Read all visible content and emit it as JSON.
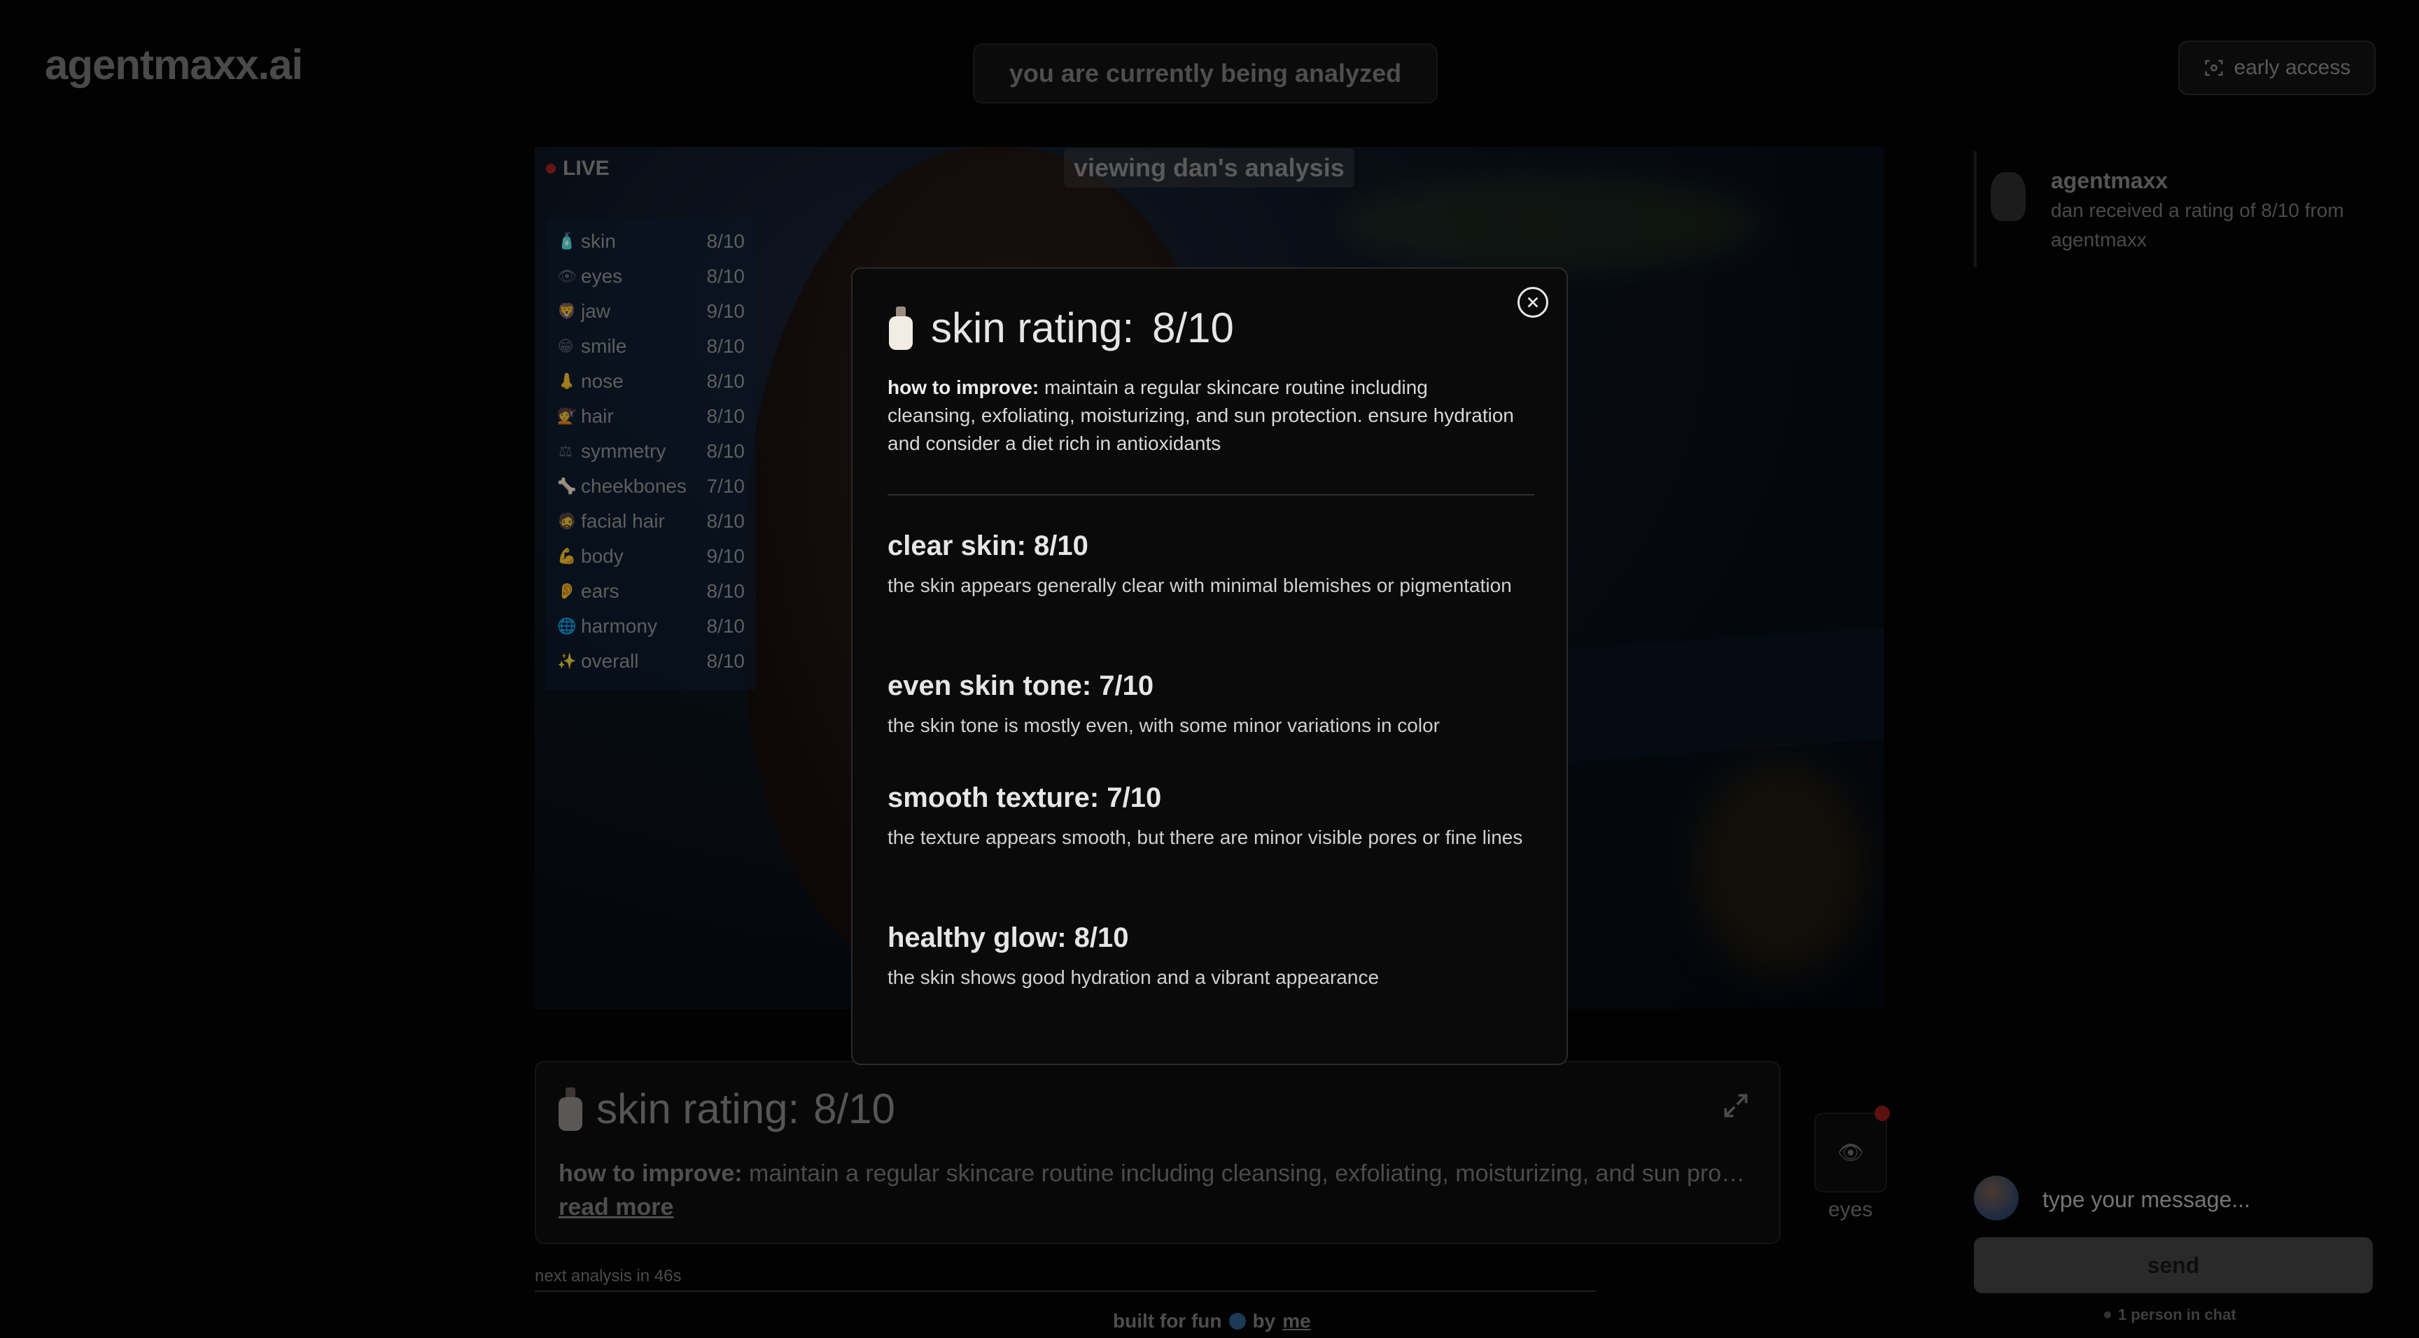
{
  "header": {
    "brand": "agentmaxx.ai",
    "status_pill": "you are currently being analyzed",
    "early_access_label": "early access"
  },
  "video": {
    "live_label": "LIVE",
    "viewing_label": "viewing dan's analysis",
    "ratings": [
      {
        "icon": "🧴",
        "label": "skin",
        "score": "8/10"
      },
      {
        "icon": "👁",
        "label": "eyes",
        "score": "8/10"
      },
      {
        "icon": "🦁",
        "label": "jaw",
        "score": "9/10"
      },
      {
        "icon": "😁",
        "label": "smile",
        "score": "8/10"
      },
      {
        "icon": "👃",
        "label": "nose",
        "score": "8/10"
      },
      {
        "icon": "💇",
        "label": "hair",
        "score": "8/10"
      },
      {
        "icon": "⚖",
        "label": "symmetry",
        "score": "8/10"
      },
      {
        "icon": "🦴",
        "label": "cheekbones",
        "score": "7/10"
      },
      {
        "icon": "🧔",
        "label": "facial hair",
        "score": "8/10"
      },
      {
        "icon": "💪",
        "label": "body",
        "score": "9/10"
      },
      {
        "icon": "👂",
        "label": "ears",
        "score": "8/10"
      },
      {
        "icon": "🌐",
        "label": "harmony",
        "score": "8/10"
      },
      {
        "icon": "✨",
        "label": "overall",
        "score": "8/10"
      }
    ]
  },
  "modal": {
    "title_label": "skin rating:",
    "title_score": "8/10",
    "improve_label": "how to improve:",
    "improve_text": "maintain a regular skincare routine including cleansing, exfoliating, moisturizing, and sun protection. ensure hydration and consider a diet rich in antioxidants",
    "sections": [
      {
        "heading": "clear skin: 8/10",
        "text": "the skin appears generally clear with minimal blemishes or pigmentation"
      },
      {
        "heading": "even skin tone: 7/10",
        "text": "the skin tone is mostly even, with some minor variations in color"
      },
      {
        "heading": "smooth texture: 7/10",
        "text": "the texture appears smooth, but there are minor visible pores or fine lines"
      },
      {
        "heading": "healthy glow: 8/10",
        "text": "the skin shows good hydration and a vibrant appearance"
      }
    ]
  },
  "card": {
    "title_label": "skin rating:",
    "title_score": "8/10",
    "improve_label": "how to improve:",
    "improve_text": "maintain a regular skincare routine including cleansing, exfoliating, moisturizing, and sun protection. ensure hydration and consider a diet rich in antioxidants",
    "read_more": "read more"
  },
  "side_indicator": {
    "label": "eyes"
  },
  "status": {
    "next_analysis": "next analysis in 46s"
  },
  "footer": {
    "text": "built for fun",
    "by": "by",
    "link": "me"
  },
  "chat": {
    "messages": [
      {
        "name": "agentmaxx",
        "text": "dan received a rating of 8/10 from agentmaxx"
      }
    ],
    "input_placeholder": "type your message...",
    "send_label": "send",
    "people_count": "1 person in chat"
  },
  "colors": {
    "background": "#020202",
    "modal_bg": "#0a0a0a",
    "live_dot": "#6a1414"
  }
}
